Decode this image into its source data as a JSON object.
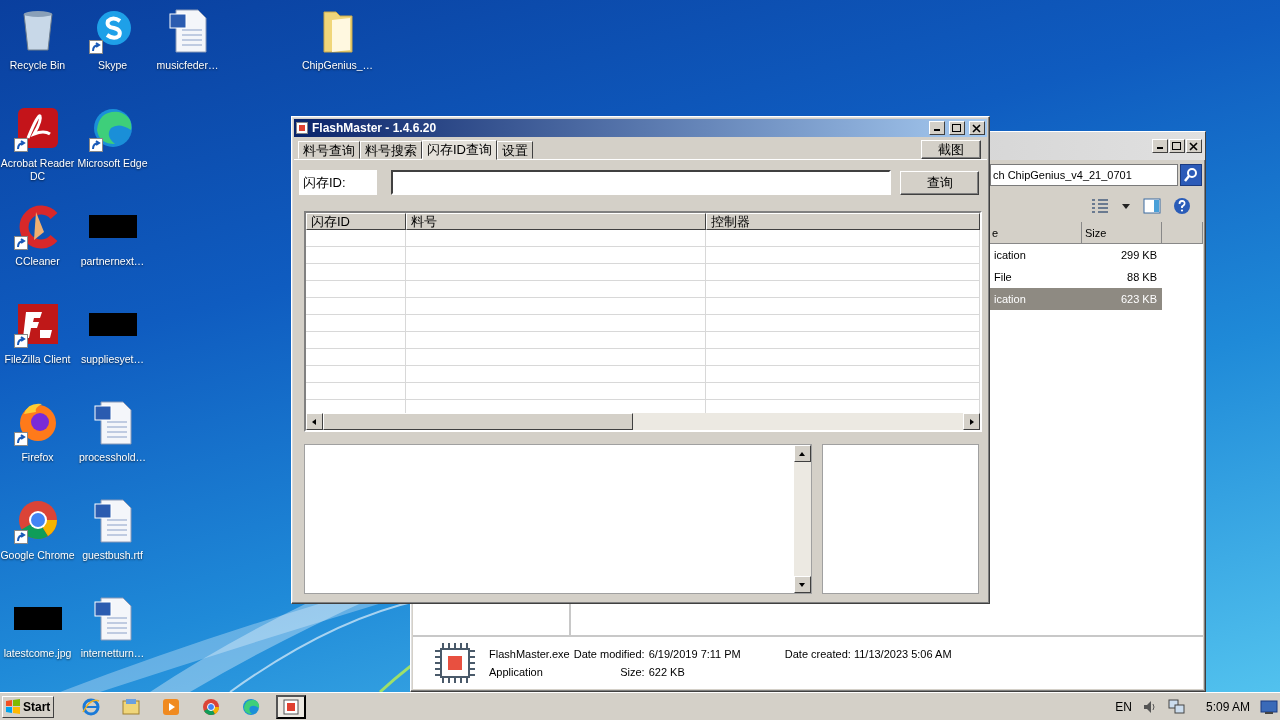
{
  "desktop_icons": [
    {
      "label": "Recycle Bin",
      "kind": "recycle_bin",
      "shortcut": false
    },
    {
      "label": "Acrobat Reader DC",
      "kind": "acrobat",
      "shortcut": true
    },
    {
      "label": "CCleaner",
      "kind": "ccleaner",
      "shortcut": true
    },
    {
      "label": "FileZilla Client",
      "kind": "filezilla",
      "shortcut": true
    },
    {
      "label": "Firefox",
      "kind": "firefox",
      "shortcut": true
    },
    {
      "label": "Google Chrome",
      "kind": "chrome",
      "shortcut": true
    },
    {
      "label": "latestcome.jpg",
      "kind": "thumbnail",
      "shortcut": false
    },
    {
      "label": "Skype",
      "kind": "skype",
      "shortcut": true
    },
    {
      "label": "Microsoft Edge",
      "kind": "edge",
      "shortcut": true
    },
    {
      "label": "partnernext…",
      "kind": "thumbnail",
      "shortcut": false
    },
    {
      "label": "suppliesyet…",
      "kind": "thumbnail",
      "shortcut": false
    },
    {
      "label": "processhold…",
      "kind": "word_doc",
      "shortcut": false
    },
    {
      "label": "guestbush.rtf",
      "kind": "word_doc",
      "shortcut": false
    },
    {
      "label": "internetturn…",
      "kind": "word_doc",
      "shortcut": false
    },
    {
      "label": "musicfeder…",
      "kind": "word_doc",
      "shortcut": false
    },
    {
      "label": "ChipGenius_…",
      "kind": "folder",
      "shortcut": false
    }
  ],
  "explorer_window": {
    "search": {
      "value": "ch ChipGenius_v4_21_0701"
    },
    "columns": [
      "e",
      "Size"
    ],
    "files": [
      {
        "type": "ication",
        "size": "299 KB",
        "selected": false
      },
      {
        "type": "File",
        "size": "88 KB",
        "selected": false
      },
      {
        "type": "ication",
        "size": "623 KB",
        "selected": true
      }
    ],
    "details": {
      "name": "FlashMaster.exe",
      "type": "Application",
      "date_modified_label": "Date modified:",
      "date_modified": "6/19/2019 7:11 PM",
      "size_label": "Size:",
      "size": "622 KB",
      "date_created_label": "Date created:",
      "date_created": "11/13/2023 5:06 AM"
    }
  },
  "flashmaster_window": {
    "title": "FlashMaster - 1.4.6.20",
    "tabs": [
      {
        "label": "料号查询",
        "selected": false
      },
      {
        "label": "料号搜索",
        "selected": false
      },
      {
        "label": "闪存ID查询",
        "selected": true
      },
      {
        "label": "设置",
        "selected": false
      }
    ],
    "screenshot_button": "截图",
    "id_label": "闪存ID:",
    "query_button": "查询",
    "table": {
      "columns": [
        "闪存ID",
        "料号",
        "控制器"
      ]
    }
  },
  "taskbar": {
    "start": "Start",
    "apps": [
      {
        "kind": "ie",
        "active": false
      },
      {
        "kind": "explorer",
        "active": false
      },
      {
        "kind": "media",
        "active": false
      },
      {
        "kind": "chrome",
        "active": false
      },
      {
        "kind": "edge",
        "active": false
      },
      {
        "kind": "flashmaster",
        "active": true
      }
    ],
    "language": "EN",
    "clock": "5:09 AM"
  }
}
